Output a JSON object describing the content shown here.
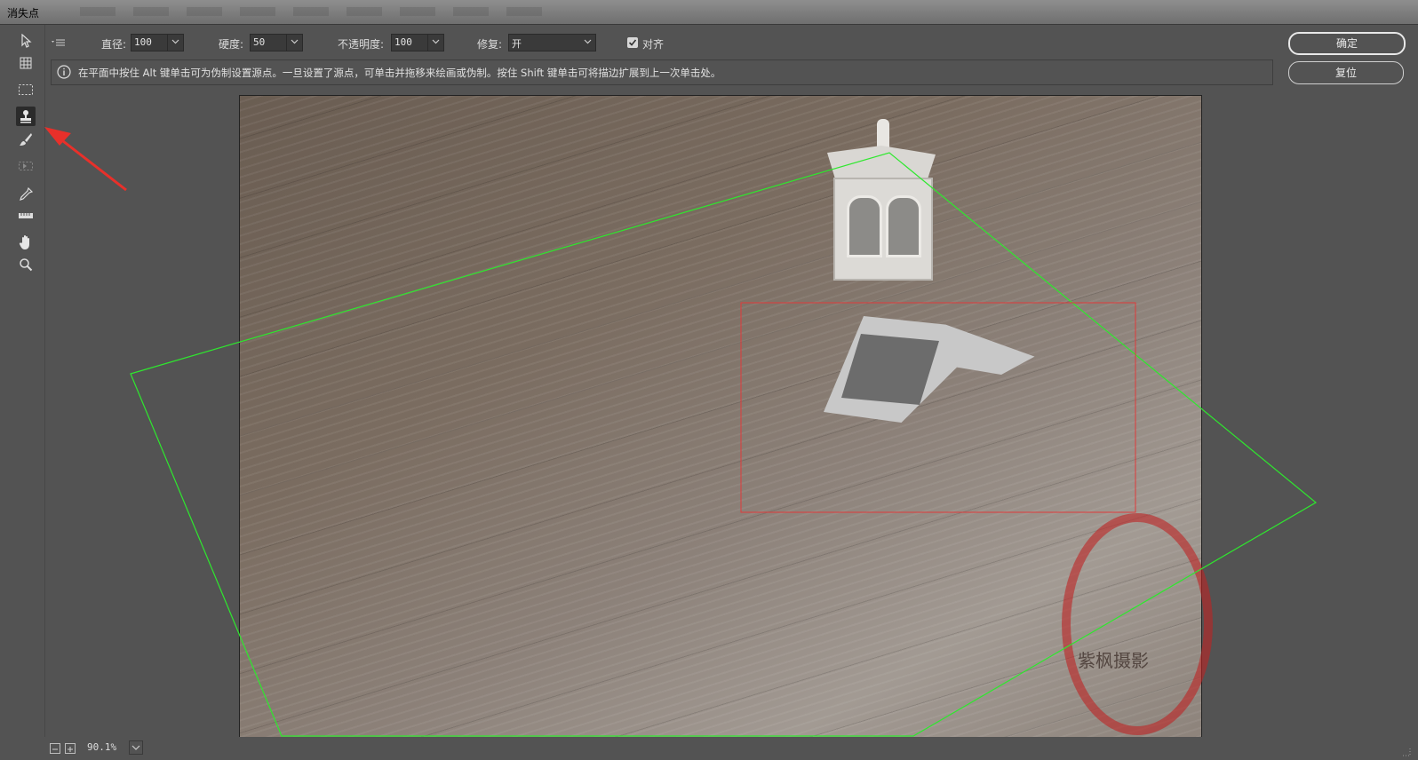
{
  "window": {
    "title": "消失点"
  },
  "options": {
    "diameter_label": "直径:",
    "diameter_value": "100",
    "hardness_label": "硬度:",
    "hardness_value": "50",
    "opacity_label": "不透明度:",
    "opacity_value": "100",
    "heal_label": "修复:",
    "heal_value": "开",
    "align_label": "对齐",
    "align_checked": true
  },
  "info": {
    "text": "在平面中按住 Alt 键单击可为伪制设置源点。一旦设置了源点，可单击并拖移来绘画或伪制。按住 Shift 键单击可将描边扩展到上一次单击处。"
  },
  "buttons": {
    "ok": "确定",
    "reset": "复位"
  },
  "status": {
    "zoom": "90.1%"
  },
  "tools": [
    "edit-plane-icon",
    "create-plane-icon",
    "marquee-icon",
    "stamp-icon",
    "brush-icon",
    "transform-icon",
    "eyedropper-icon",
    "measure-icon",
    "hand-icon",
    "zoom-icon"
  ],
  "photo": {
    "watermark": "紫枫摄影"
  },
  "colors": {
    "plane_grid": "#2ee82e",
    "selection": "#e03a3a",
    "annotation_arrow": "#e8302a"
  }
}
